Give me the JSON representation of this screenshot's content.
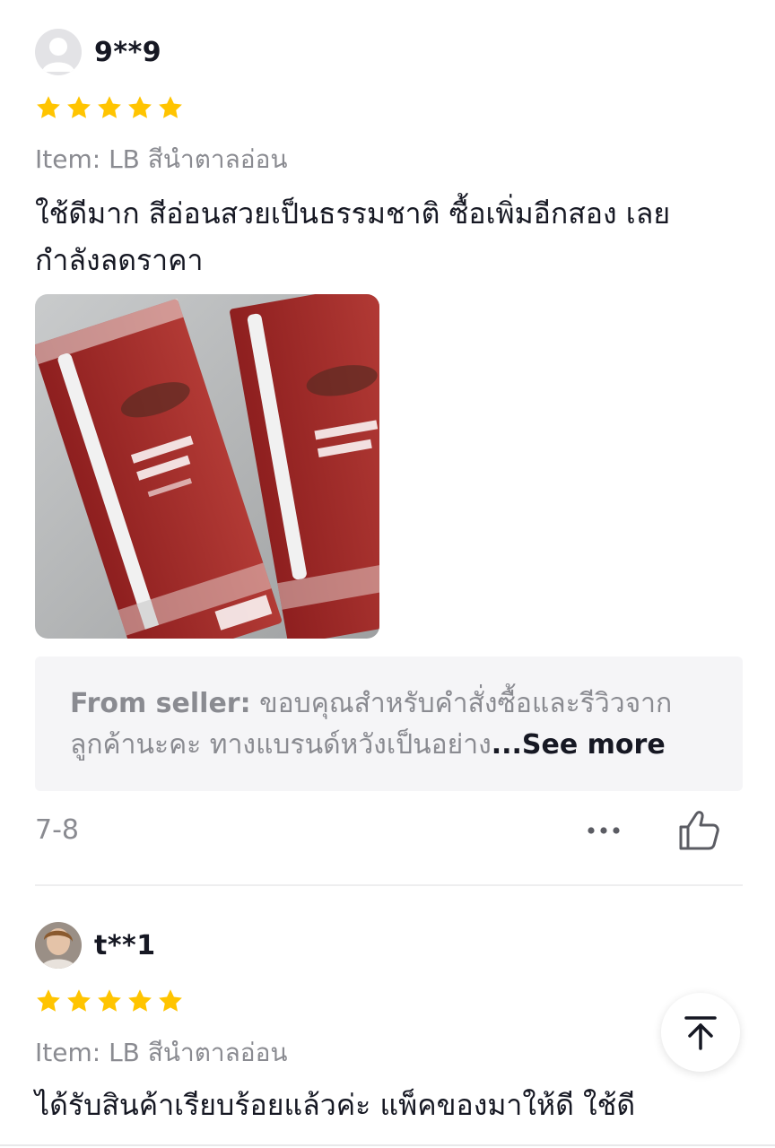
{
  "reviews": [
    {
      "username": "9**9",
      "rating": 5,
      "item": "Item: LB สีนำตาลอ่อน",
      "text": "ใช้ดีมาก สีอ่อนสวยเป็นธรรมชาติ ซื้อเพิ่มอีกสอง เลย กำลังลดราคา",
      "photo_icon": "eyebrow-pencil-product-photo",
      "seller_reply": {
        "label": "From seller:",
        "text": " ขอบคุณสำหรับคำสั่งซื้อและรีวิวจากลูกค้านะคะ ทางแบรนด์หวังเป็นอย่าง",
        "see_more": "...See more"
      },
      "date": "7-8"
    },
    {
      "username": "t**1",
      "rating": 5,
      "item": "Item: LB สีนำตาลอ่อน",
      "text": "ได้รับสินค้าเรียบร้อยแล้วค่ะ แพ็คของมาให้ดี ใช้ดี"
    }
  ],
  "colors": {
    "star": "#FFC400",
    "secondary_text": "#8A8B91",
    "primary_text": "#161823",
    "seller_box_bg": "#F5F5F7"
  },
  "icons": {
    "more": "more-horizontal-icon",
    "like": "thumbs-up-icon",
    "back_to_top": "arrow-up-to-top-icon"
  }
}
